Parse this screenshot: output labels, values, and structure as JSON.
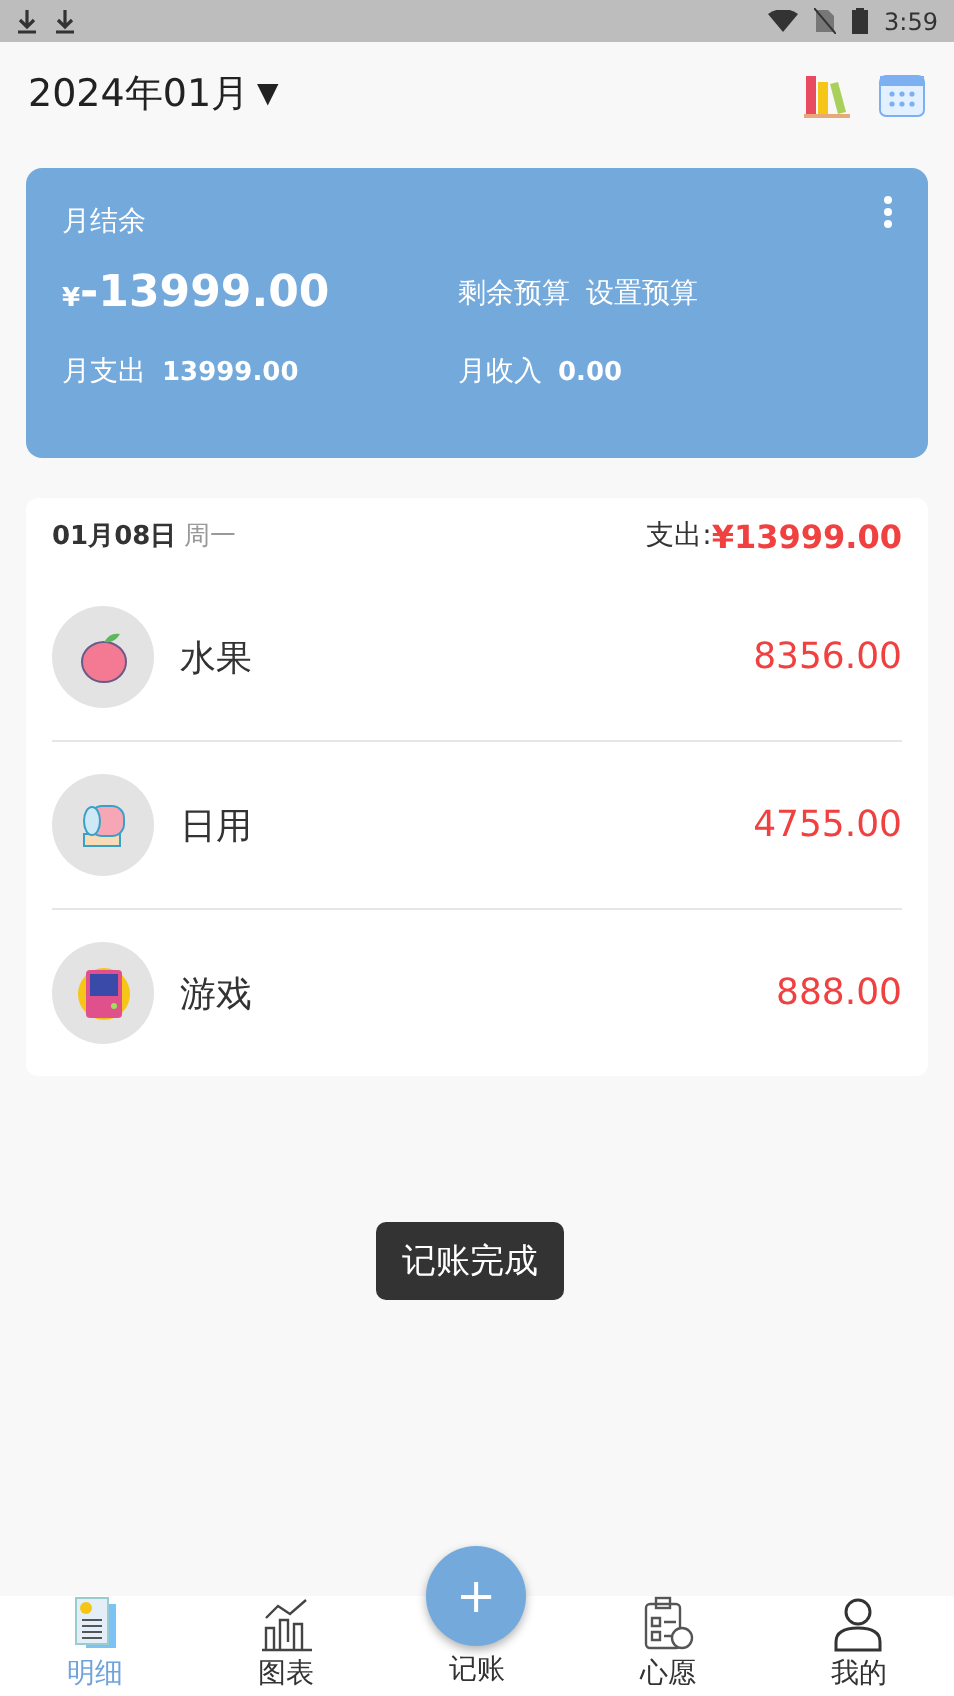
{
  "status_bar": {
    "time": "3:59"
  },
  "header": {
    "month": "2024年01月",
    "dropdown": "▼"
  },
  "summary": {
    "title": "月结余",
    "balance_currency": "¥",
    "balance": "-13999.00",
    "remaining_budget": "剩余预算",
    "set_budget": "设置预算",
    "expense_label": "月支出",
    "expense": "13999.00",
    "income_label": "月收入",
    "income": "0.00"
  },
  "day": {
    "date": "01月08日",
    "weekday": "周一",
    "total_label": "支出:",
    "total": "¥13999.00",
    "entries": [
      {
        "kind": "fruit",
        "name": "水果",
        "amount": "8356.00"
      },
      {
        "kind": "daily",
        "name": "日用",
        "amount": "4755.00"
      },
      {
        "kind": "game",
        "name": "游戏",
        "amount": "888.00"
      }
    ]
  },
  "toast": "记账完成",
  "fab": "+",
  "tabs": [
    {
      "kind": "detail",
      "label": "明细",
      "selected": true
    },
    {
      "kind": "chart",
      "label": "图表",
      "selected": false
    },
    {
      "kind": "add",
      "label": "记账",
      "selected": false
    },
    {
      "kind": "wish",
      "label": "心愿",
      "selected": false
    },
    {
      "kind": "me",
      "label": "我的",
      "selected": false
    }
  ]
}
